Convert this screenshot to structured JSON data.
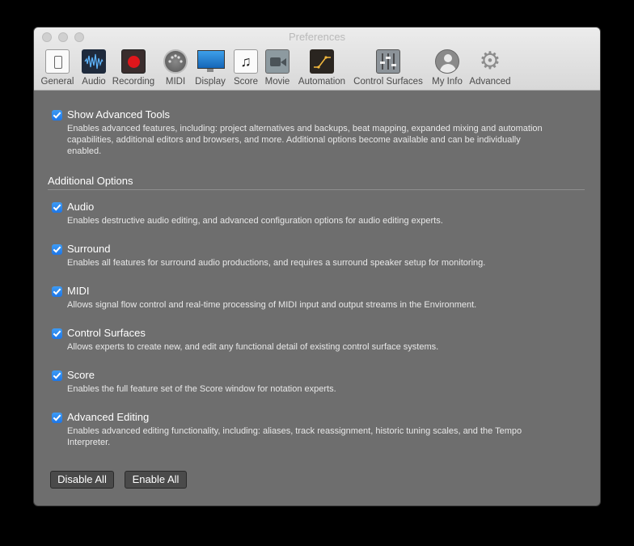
{
  "window": {
    "title": "Preferences"
  },
  "toolbar": [
    {
      "key": "general",
      "label": "General",
      "icon": "general-icon"
    },
    {
      "key": "audio",
      "label": "Audio",
      "icon": "audio-waveform-icon"
    },
    {
      "key": "recording",
      "label": "Recording",
      "icon": "record-icon"
    },
    {
      "key": "midi",
      "label": "MIDI",
      "icon": "midi-connector-icon"
    },
    {
      "key": "display",
      "label": "Display",
      "icon": "monitor-icon"
    },
    {
      "key": "score",
      "label": "Score",
      "icon": "music-note-icon"
    },
    {
      "key": "movie",
      "label": "Movie",
      "icon": "movie-camera-icon"
    },
    {
      "key": "automation",
      "label": "Automation",
      "icon": "automation-curve-icon"
    },
    {
      "key": "control_surfaces",
      "label": "Control Surfaces",
      "icon": "faders-icon"
    },
    {
      "key": "my_info",
      "label": "My Info",
      "icon": "user-icon"
    },
    {
      "key": "advanced",
      "label": "Advanced",
      "icon": "gear-icon"
    }
  ],
  "main": {
    "show_advanced": {
      "label": "Show Advanced Tools",
      "checked": true,
      "desc_lines": [
        "Enables advanced features, including: project alternatives and backups, beat mapping, expanded mixing and automation",
        "capabilities, additional editors and browsers, and more. Additional options become available and can be individually",
        "enabled."
      ]
    },
    "section_title": "Additional Options",
    "options": [
      {
        "label": "Audio",
        "checked": true,
        "desc": [
          "Enables destructive audio editing, and advanced configuration options for audio editing experts."
        ]
      },
      {
        "label": "Surround",
        "checked": true,
        "desc": [
          "Enables all features for surround audio productions, and requires a surround speaker setup for monitoring."
        ]
      },
      {
        "label": "MIDI",
        "checked": true,
        "desc": [
          "Allows signal flow control and real-time processing of MIDI input and output streams in the Environment."
        ]
      },
      {
        "label": "Control Surfaces",
        "checked": true,
        "desc": [
          "Allows experts to create new, and edit any functional detail of existing control surface systems."
        ]
      },
      {
        "label": "Score",
        "checked": true,
        "desc": [
          "Enables the full feature set of the Score window for notation experts."
        ]
      },
      {
        "label": "Advanced Editing",
        "checked": true,
        "desc": [
          "Enables advanced editing functionality, including: aliases, track reassignment, historic tuning scales, and the Tempo",
          "Interpreter."
        ]
      }
    ],
    "buttons": {
      "disable_all": "Disable All",
      "enable_all": "Enable All"
    }
  },
  "colors": {
    "accent": "#1d76e8",
    "background": "#6e6e6e",
    "record_red": "#e0161b"
  }
}
